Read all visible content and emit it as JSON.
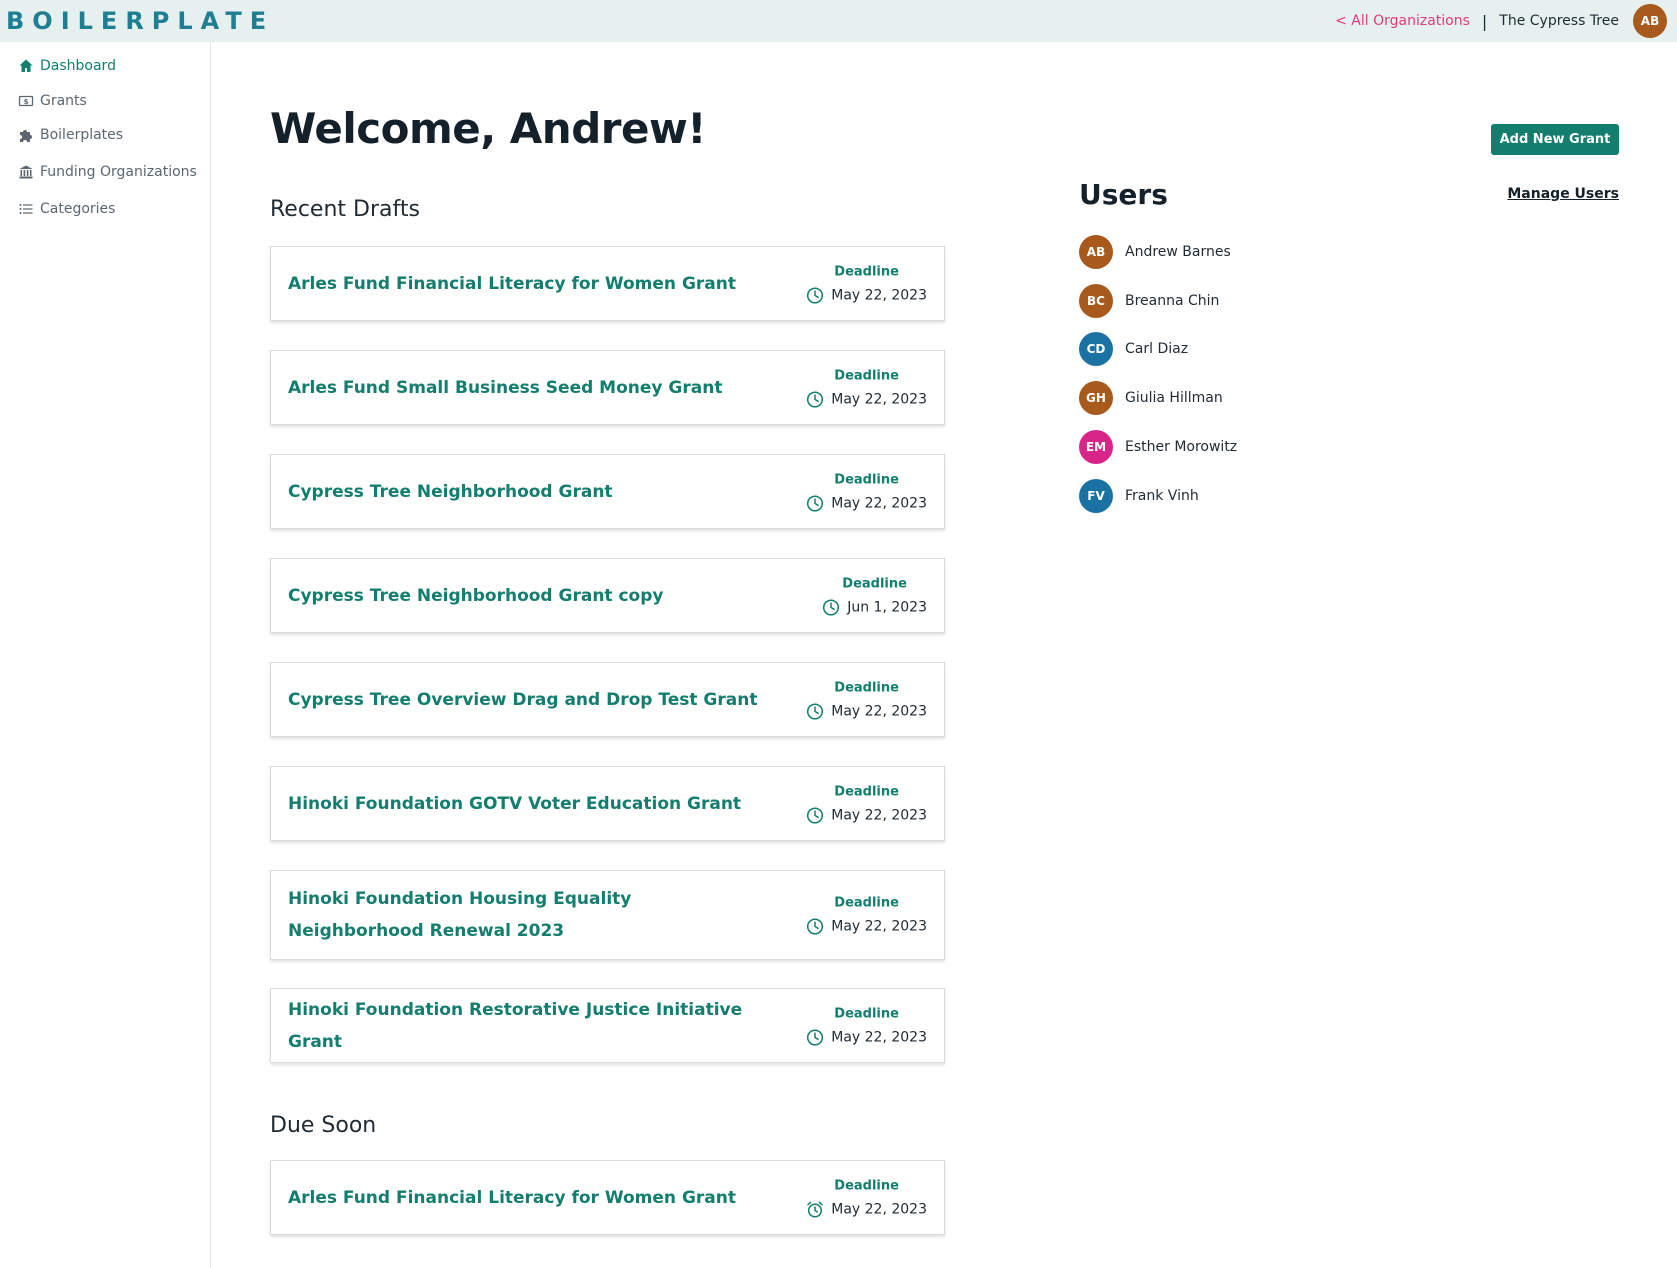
{
  "app": {
    "logo": "BOILERPLATE"
  },
  "header": {
    "all_orgs_link": "< All Organizations",
    "separator": "|",
    "org_name": "The Cypress Tree",
    "user_initials": "AB",
    "user_avatar_color": "#a85a1c"
  },
  "sidebar": {
    "items": [
      {
        "label": "Dashboard",
        "icon": "home-icon",
        "active": true
      },
      {
        "label": "Grants",
        "icon": "dollar-bill-icon",
        "active": false
      },
      {
        "label": "Boilerplates",
        "icon": "puzzle-icon",
        "active": false
      },
      {
        "label": "Funding Organizations",
        "icon": "bank-icon",
        "active": false
      },
      {
        "label": "Categories",
        "icon": "list-icon",
        "active": false
      }
    ]
  },
  "main": {
    "welcome": "Welcome, Andrew!",
    "add_grant_button": "Add New Grant",
    "recent_drafts": {
      "title": "Recent Drafts",
      "items": [
        {
          "title": "Arles Fund Financial Literacy for Women Grant",
          "deadline_label": "Deadline",
          "deadline": "May 22, 2023"
        },
        {
          "title": "Arles Fund Small Business Seed Money Grant",
          "deadline_label": "Deadline",
          "deadline": "May 22, 2023"
        },
        {
          "title": "Cypress Tree Neighborhood Grant",
          "deadline_label": "Deadline",
          "deadline": "May 22, 2023"
        },
        {
          "title": "Cypress Tree Neighborhood Grant copy",
          "deadline_label": "Deadline",
          "deadline": "Jun 1, 2023"
        },
        {
          "title": "Cypress Tree Overview Drag and Drop Test Grant",
          "deadline_label": "Deadline",
          "deadline": "May 22, 2023"
        },
        {
          "title": "Hinoki Foundation GOTV Voter Education Grant",
          "deadline_label": "Deadline",
          "deadline": "May 22, 2023"
        },
        {
          "title": "Hinoki Foundation Housing Equality Neighborhood Renewal 2023",
          "deadline_label": "Deadline",
          "deadline": "May 22, 2023"
        },
        {
          "title": "Hinoki Foundation Restorative Justice Initiative Grant",
          "deadline_label": "Deadline",
          "deadline": "May 22, 2023"
        }
      ]
    },
    "due_soon": {
      "title": "Due Soon",
      "items": [
        {
          "title": "Arles Fund Financial Literacy for Women Grant",
          "deadline_label": "Deadline",
          "deadline": "May 22, 2023"
        }
      ]
    }
  },
  "users": {
    "title": "Users",
    "manage_link": "Manage Users",
    "list": [
      {
        "initials": "AB",
        "name": "Andrew Barnes",
        "color": "#a85a1c"
      },
      {
        "initials": "BC",
        "name": "Breanna Chin",
        "color": "#a85a1c"
      },
      {
        "initials": "CD",
        "name": "Carl Diaz",
        "color": "#1a73a3"
      },
      {
        "initials": "GH",
        "name": "Giulia Hillman",
        "color": "#a85a1c"
      },
      {
        "initials": "EM",
        "name": "Esther Morowitz",
        "color": "#d8258a"
      },
      {
        "initials": "FV",
        "name": "Frank Vinh",
        "color": "#1a73a3"
      }
    ]
  },
  "colors": {
    "accent": "#137d6e",
    "link_pink": "#e03a7b",
    "topbar_bg": "#e6f1ef",
    "logo": "#1e7f93"
  }
}
